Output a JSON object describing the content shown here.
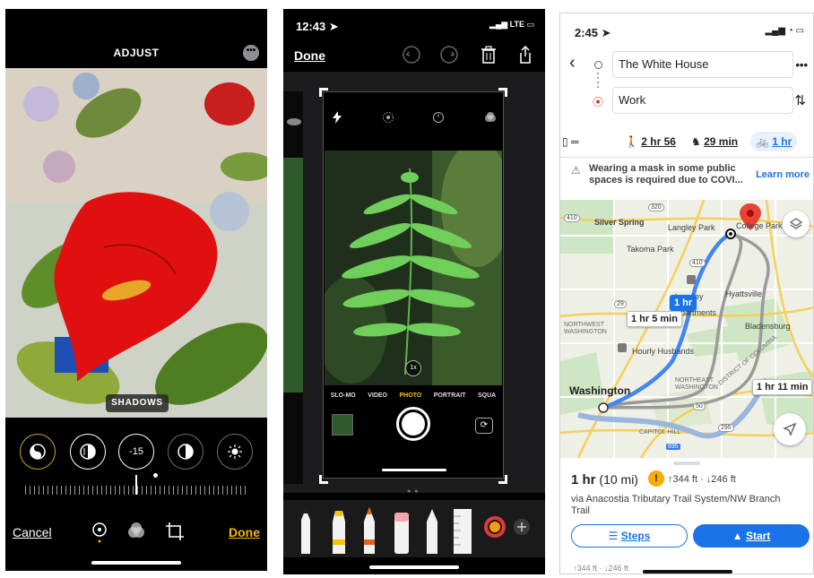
{
  "photos": {
    "title": "ADJUST",
    "more_icon": "ellipsis-icon",
    "selected_tool_label": "SHADOWS",
    "adjust_value": "-15",
    "cancel_label": "Cancel",
    "done_label": "Done",
    "accent": "#f5b700"
  },
  "camera": {
    "time": "12:43",
    "network": "LTE",
    "done_label": "Done",
    "zoom_label": "1x",
    "modes": [
      "SLO-MO",
      "VIDEO",
      "PHOTO",
      "PORTRAIT",
      "SQUA"
    ],
    "active_mode": "PHOTO",
    "active_mode_color": "#f5c518"
  },
  "maps": {
    "time": "2:45",
    "origin": "The White House",
    "destination": "Work",
    "modes": {
      "walk": "2 hr 56",
      "ride": "29 min",
      "bike": "1 hr"
    },
    "alert": "Wearing a mask in some public spaces is required due to COVI...",
    "learn_more": "Learn more",
    "map_labels": {
      "silver_spring": "Silver Spring",
      "langley_park": "Langley Park",
      "college_park": "College Park",
      "takoma_park": "Takoma Park",
      "hyattsville": "Hyattsville",
      "bladensburg": "Bladensburg",
      "northwest_washington": "NORTHWEST WASHINGTON",
      "hourly_husbands": "Hourly Husbands",
      "washington": "Washington",
      "northeast_washington": "NORTHEAST WASHINGTON",
      "capitol_hill": "CAPITOL HILL",
      "district_of_columbia": "DISTRICT OF COLUMBIA",
      "langley_park_apts": "Langley Park Apartments",
      "r410a": "410",
      "r410b": "410",
      "r320": "320",
      "r29": "29",
      "r50": "50",
      "r295": "295",
      "r695": "695"
    },
    "route_times": {
      "selected": "1 hr",
      "alt1": "1 hr 5 min",
      "alt2": "1 hr 11 min"
    },
    "summary_duration": "1 hr",
    "summary_distance": "(10 mi)",
    "elevation": "↑344 ft · ↓246 ft",
    "via": "via Anacostia Tributary Trail System/NW Branch Trail",
    "steps_label": "Steps",
    "start_label": "Start",
    "elevation_footer": "↑344 ft · ↓246 ft",
    "route_color": "#4285f4",
    "accent": "#1a73e8"
  }
}
